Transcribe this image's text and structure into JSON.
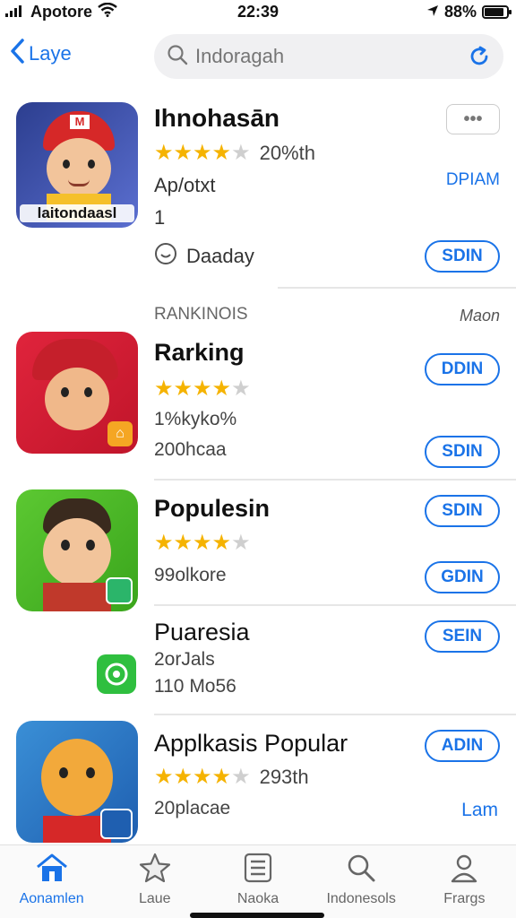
{
  "status_bar": {
    "carrier": "Apotore",
    "time": "22:39",
    "battery": "88%",
    "battery_level": 0.88
  },
  "nav": {
    "back_label": "Laye",
    "search_placeholder": "Indoragah"
  },
  "featured": {
    "title": "Ihnohasān",
    "rating_stars": 4,
    "rating_text": "20%th",
    "subtitle": "Ap/otxt",
    "number": "1",
    "meta": "Daaday",
    "icon_caption": "laitondaasl",
    "icon_badge": "M",
    "more_label": "•••",
    "link_label": "DPIAM",
    "button_label": "SDIN"
  },
  "section": {
    "header": "RANKINOIS",
    "link": "Maon"
  },
  "apps": [
    {
      "title": "Rarking",
      "rating_stars": 4,
      "line1": "1%kyko%",
      "line2": "200hcaa",
      "button_top": "DDIN",
      "button_bottom": "SDIN"
    },
    {
      "title": "Populesin",
      "rating_stars": 4,
      "line1": "99olkore",
      "button_top": "SDIN",
      "button_bottom": "GDIN"
    },
    {
      "title": "Puaresia",
      "line1": "2orJals",
      "line2": "110 Mo56",
      "button_top": "SEIN"
    },
    {
      "title": "Applkasis Popular",
      "rating_stars": 4,
      "rating_text": "293th",
      "line2": "20placae",
      "button_top": "ADIN",
      "link_label": "Lam"
    }
  ],
  "tabs": [
    {
      "label": "Aonamlen",
      "icon": "home-icon",
      "active": true
    },
    {
      "label": "Laue",
      "icon": "star-icon",
      "active": false
    },
    {
      "label": "Naoka",
      "icon": "list-icon",
      "active": false
    },
    {
      "label": "Indonesols",
      "icon": "search-icon",
      "active": false
    },
    {
      "label": "Frargs",
      "icon": "person-icon",
      "active": false
    }
  ],
  "colors": {
    "accent": "#1a73e8",
    "star": "#f5b301"
  }
}
